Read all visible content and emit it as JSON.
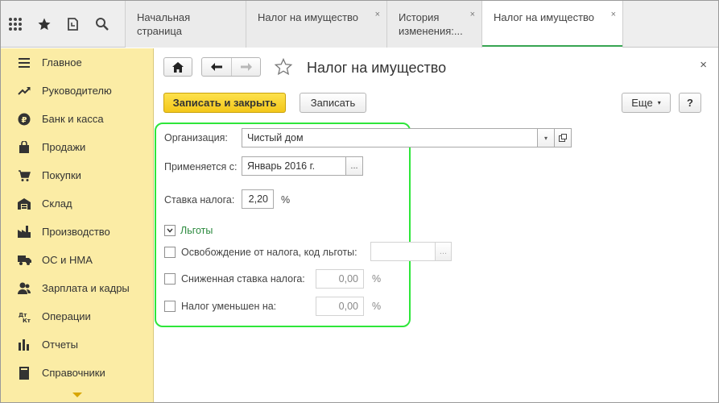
{
  "top_icons": [
    "apps-grid-icon",
    "star-icon",
    "history-icon",
    "search-icon"
  ],
  "tabs": [
    {
      "label": "Начальная страница",
      "closable": false,
      "active": false
    },
    {
      "label": "Налог на имущество",
      "closable": true,
      "active": false
    },
    {
      "label": "История изменения:...",
      "closable": true,
      "active": false
    },
    {
      "label": "Налог на имущество",
      "closable": true,
      "active": true
    }
  ],
  "tab_close_glyph": "×",
  "sidebar": {
    "items": [
      {
        "label": "Главное",
        "icon": "menu-lines-icon"
      },
      {
        "label": "Руководителю",
        "icon": "trend-up-icon"
      },
      {
        "label": "Банк и касса",
        "icon": "ruble-coin-icon"
      },
      {
        "label": "Продажи",
        "icon": "shopping-bag-icon"
      },
      {
        "label": "Покупки",
        "icon": "shopping-cart-icon"
      },
      {
        "label": "Склад",
        "icon": "warehouse-icon"
      },
      {
        "label": "Производство",
        "icon": "factory-icon"
      },
      {
        "label": "ОС и НМА",
        "icon": "truck-icon"
      },
      {
        "label": "Зарплата и кадры",
        "icon": "people-icon"
      },
      {
        "label": "Операции",
        "icon": "debit-credit-icon"
      },
      {
        "label": "Отчеты",
        "icon": "bar-chart-icon"
      },
      {
        "label": "Справочники",
        "icon": "book-icon"
      }
    ]
  },
  "form": {
    "title": "Налог на имущество",
    "close_glyph": "×",
    "buttons": {
      "save_close": "Записать и закрыть",
      "save": "Записать",
      "more": "Еще",
      "help": "?"
    },
    "fields": {
      "organization_label": "Организация:",
      "organization_value": "Чистый дом",
      "applies_from_label": "Применяется с:",
      "applies_from_value": "Январь 2016 г.",
      "rate_label": "Ставка налога:",
      "rate_value": "2,20",
      "rate_unit": "%",
      "select_glyph": "...",
      "dropdown_glyph": "▾"
    },
    "benefits": {
      "group_title": "Льготы",
      "expanded": true,
      "exemption_label": "Освобождение от налога, код льготы:",
      "exemption_value": "",
      "exemption_checked": false,
      "reduced_rate_label": "Сниженная ставка налога:",
      "reduced_rate_value": "0,00",
      "reduced_rate_unit": "%",
      "reduced_rate_checked": false,
      "tax_reduced_label": "Налог уменьшен на:",
      "tax_reduced_value": "0,00",
      "tax_reduced_unit": "%",
      "tax_reduced_checked": false
    }
  },
  "colors": {
    "sidebar_bg": "#fbeca5",
    "accent_yellow": "#f3c71a",
    "active_tab_underline": "#37a552",
    "highlight_border": "#2ee63a",
    "group_title": "#2b8a3e"
  }
}
